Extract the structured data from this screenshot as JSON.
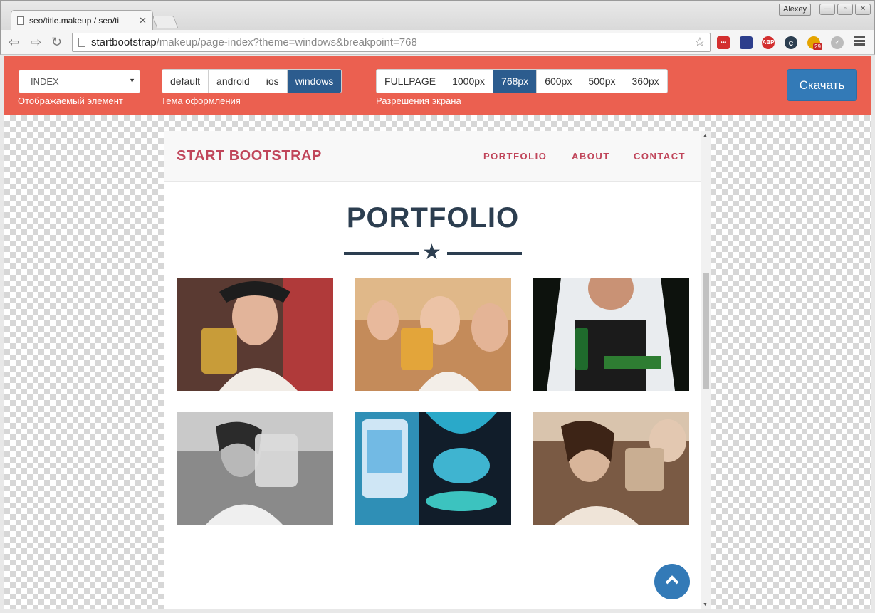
{
  "browser": {
    "tab_title": "seo/title.makeup / seo/ti",
    "tab_close": "✕",
    "user_name": "Alexey",
    "url_host": "startbootstrap",
    "url_rest": "/makeup/page-index?theme=windows&breakpoint=768",
    "extension_badge": "29",
    "abp_label": "ABP"
  },
  "toolbar": {
    "element_select_value": "INDEX",
    "element_label": "Отображаемый элемент",
    "theme_label": "Тема оформления",
    "themes": [
      "default",
      "android",
      "ios",
      "windows"
    ],
    "active_theme": "windows",
    "resolution_label": "Разрешения экрана",
    "resolutions": [
      "FULLPAGE",
      "1000px",
      "768px",
      "600px",
      "500px",
      "360px"
    ],
    "active_resolution": "768px",
    "download_label": "Скачать",
    "accent_color": "#eb6050",
    "active_color": "#2c5c8e"
  },
  "site": {
    "brand": "START BOOTSTRAP",
    "nav": [
      "PORTFOLIO",
      "ABOUT",
      "CONTACT"
    ],
    "section_title": "PORTFOLIO",
    "brand_color": "#c0455a",
    "heading_color": "#2c3e50",
    "portfolio_items": 6
  }
}
